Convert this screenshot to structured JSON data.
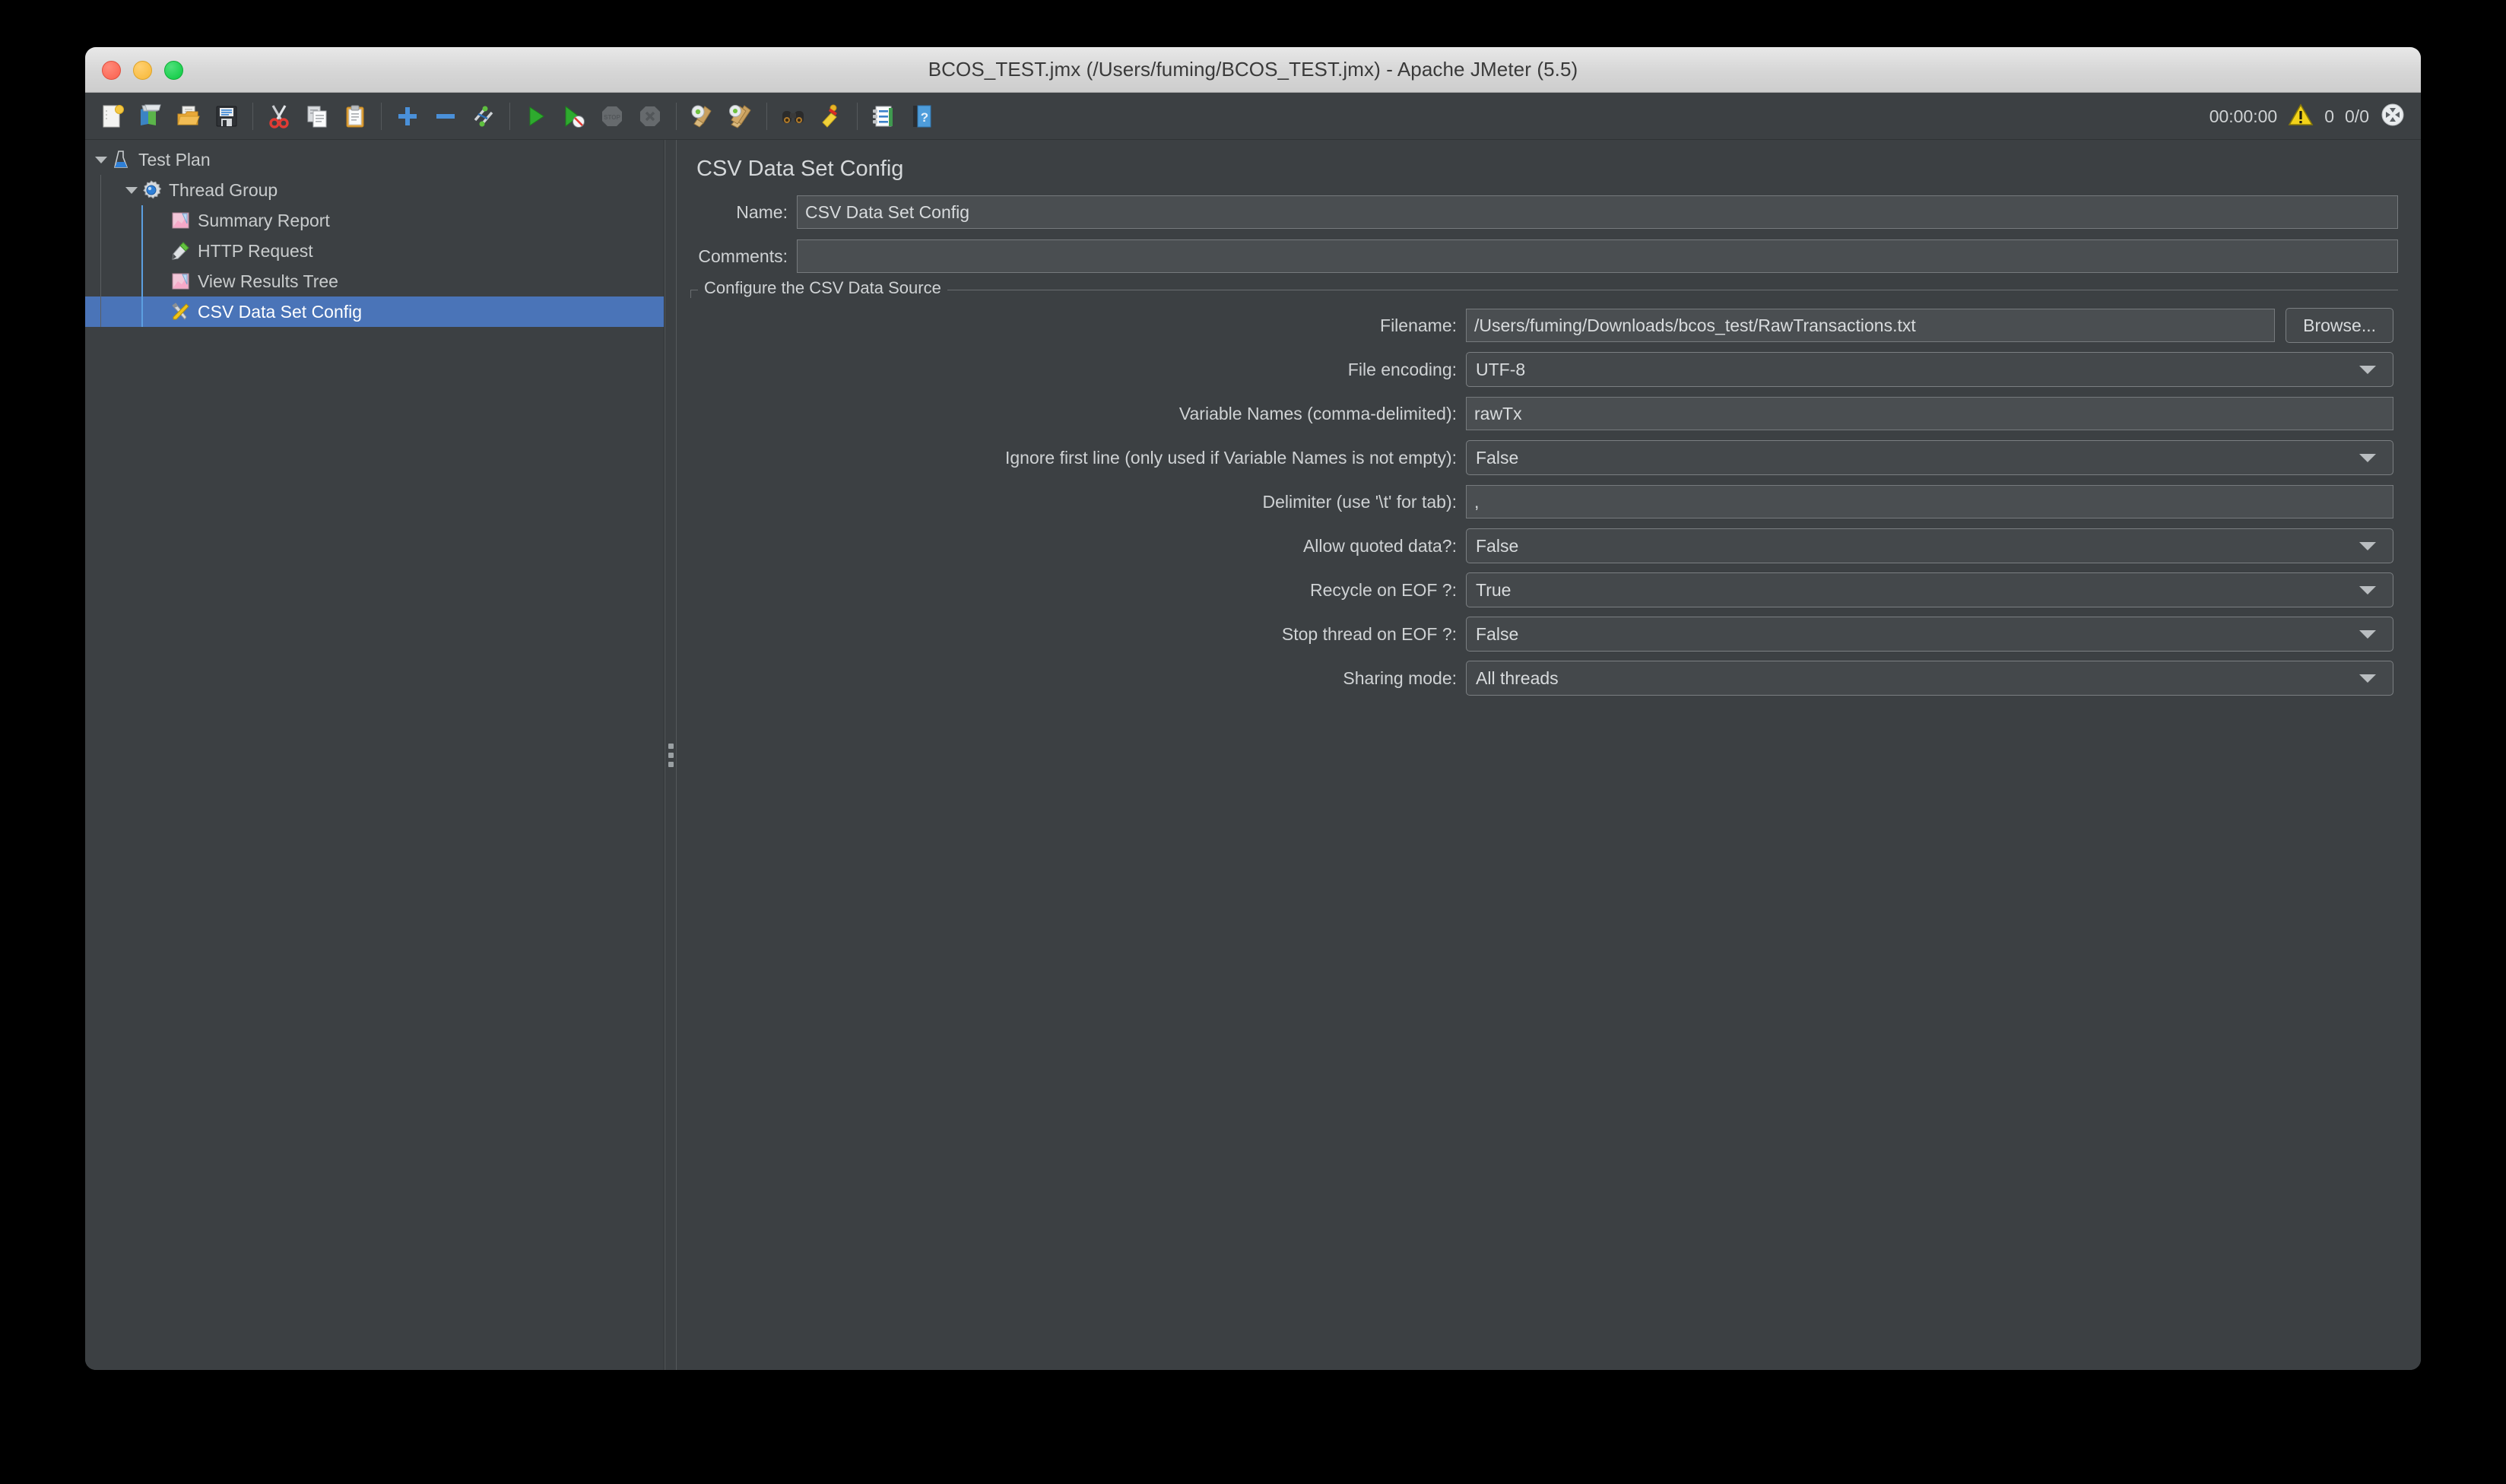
{
  "window": {
    "title": "BCOS_TEST.jmx (/Users/fuming/BCOS_TEST.jmx) - Apache JMeter (5.5)",
    "traffic_lights": {
      "close": "close-button",
      "minimize": "minimize-button",
      "maximize": "maximize-button"
    }
  },
  "toolbar": {
    "groups": [
      [
        {
          "name": "new-icon",
          "label": "New"
        },
        {
          "name": "templates-icon",
          "label": "Templates"
        },
        {
          "name": "open-icon",
          "label": "Open"
        },
        {
          "name": "save-icon",
          "label": "Save"
        }
      ],
      [
        {
          "name": "cut-icon",
          "label": "Cut"
        },
        {
          "name": "copy-icon",
          "label": "Copy"
        },
        {
          "name": "paste-icon",
          "label": "Paste"
        }
      ],
      [
        {
          "name": "expand-all-icon",
          "label": "Expand All"
        },
        {
          "name": "collapse-all-icon",
          "label": "Collapse All"
        },
        {
          "name": "toggle-icon",
          "label": "Toggle"
        }
      ],
      [
        {
          "name": "start-icon",
          "label": "Start"
        },
        {
          "name": "start-no-timers-icon",
          "label": "Start no pauses"
        },
        {
          "name": "stop-icon",
          "label": "Stop",
          "disabled": true
        },
        {
          "name": "shutdown-icon",
          "label": "Shutdown",
          "disabled": true
        }
      ],
      [
        {
          "name": "clear-icon",
          "label": "Clear"
        },
        {
          "name": "clear-all-icon",
          "label": "Clear All"
        }
      ],
      [
        {
          "name": "search-icon",
          "label": "Search"
        },
        {
          "name": "reset-search-icon",
          "label": "Reset Search"
        }
      ],
      [
        {
          "name": "function-helper-icon",
          "label": "Function Helper Dialog"
        },
        {
          "name": "help-icon",
          "label": "Help"
        }
      ]
    ],
    "status": {
      "timer": "00:00:00",
      "warning_icon": "warning-icon",
      "error_count": "0",
      "thread_count": "0/0",
      "remote_icon": "remote-status-icon"
    }
  },
  "tree": {
    "items": [
      {
        "label": "Test Plan",
        "icon": "test-plan-icon",
        "depth": 0,
        "expanded": true,
        "selected": false
      },
      {
        "label": "Thread Group",
        "icon": "thread-group-icon",
        "depth": 1,
        "expanded": true,
        "selected": false
      },
      {
        "label": "Summary Report",
        "icon": "summary-report-icon",
        "depth": 2,
        "expanded": null,
        "selected": false
      },
      {
        "label": "HTTP Request",
        "icon": "http-request-icon",
        "depth": 2,
        "expanded": null,
        "selected": false
      },
      {
        "label": "View Results Tree",
        "icon": "view-results-icon",
        "depth": 2,
        "expanded": null,
        "selected": false
      },
      {
        "label": "CSV Data Set Config",
        "icon": "csv-config-icon",
        "depth": 2,
        "expanded": null,
        "selected": true
      }
    ]
  },
  "panel": {
    "title": "CSV Data Set Config",
    "name_label": "Name:",
    "name_value": "CSV Data Set Config",
    "comments_label": "Comments:",
    "comments_value": "",
    "group_legend": "Configure the CSV Data Source",
    "rows": [
      {
        "label": "Filename:",
        "value": "/Users/fuming/Downloads/bcos_test/RawTransactions.txt",
        "type": "text",
        "name": "filename"
      },
      {
        "label": "File encoding:",
        "value": "UTF-8",
        "type": "combo",
        "name": "file-encoding"
      },
      {
        "label": "Variable Names (comma-delimited):",
        "value": "rawTx",
        "type": "text",
        "name": "variable-names"
      },
      {
        "label": "Ignore first line (only used if Variable Names is not empty):",
        "value": "False",
        "type": "combo",
        "name": "ignore-first-line"
      },
      {
        "label": "Delimiter (use '\\t' for tab):",
        "value": ",",
        "type": "text",
        "name": "delimiter"
      },
      {
        "label": "Allow quoted data?:",
        "value": "False",
        "type": "combo",
        "name": "allow-quoted-data"
      },
      {
        "label": "Recycle on EOF ?:",
        "value": "True",
        "type": "combo",
        "name": "recycle-on-eof"
      },
      {
        "label": "Stop thread on EOF ?:",
        "value": "False",
        "type": "combo",
        "name": "stop-thread-on-eof"
      },
      {
        "label": "Sharing mode:",
        "value": "All threads",
        "type": "combo",
        "name": "sharing-mode"
      }
    ],
    "browse_label": "Browse..."
  },
  "colors": {
    "background": "#3c4043",
    "field": "#4a4e51",
    "selection": "#4a74b8",
    "text": "#cfd2d4",
    "titlebar": "#d6d6d6"
  }
}
